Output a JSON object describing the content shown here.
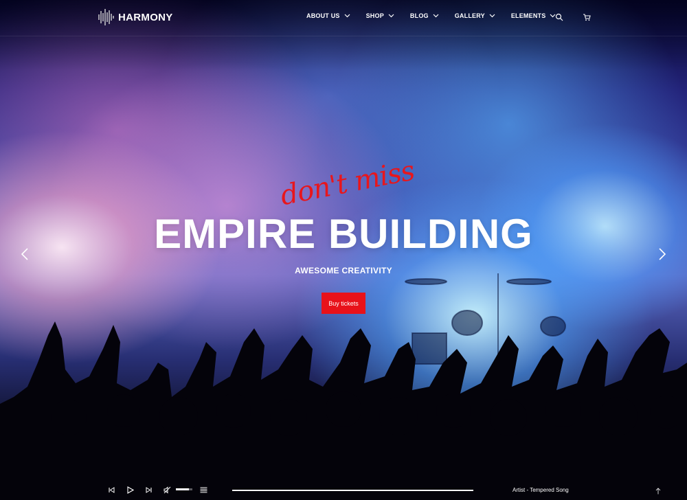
{
  "brand": {
    "name": "HARMONY",
    "logo_icon": "soundwave-icon"
  },
  "nav": {
    "items": [
      {
        "label": "ABOUT US",
        "icon": "chevron-down-icon"
      },
      {
        "label": "SHOP",
        "icon": "chevron-down-icon"
      },
      {
        "label": "BLOG",
        "icon": "chevron-down-icon"
      },
      {
        "label": "GALLERY",
        "icon": "chevron-down-icon"
      },
      {
        "label": "ELEMENTS",
        "icon": "chevron-down-icon"
      }
    ],
    "search_icon": "search-icon",
    "cart_icon": "cart-icon"
  },
  "hero": {
    "script_text": "don't miss",
    "title": "EMPIRE BUILDING",
    "subtitle": "AWESOME CREATIVITY",
    "cta_label": "Buy tickets",
    "prev_icon": "chevron-left-icon",
    "next_icon": "chevron-right-icon"
  },
  "player": {
    "controls": [
      "previous-icon",
      "play-icon",
      "next-icon",
      "mute-icon",
      "playlist-icon"
    ],
    "volume": 0.8,
    "progress": 1.0,
    "now_playing": "Artist - Tempered Song",
    "to_top_icon": "arrow-up-icon"
  },
  "colors": {
    "accent": "#e8121a",
    "text": "#ffffff"
  }
}
